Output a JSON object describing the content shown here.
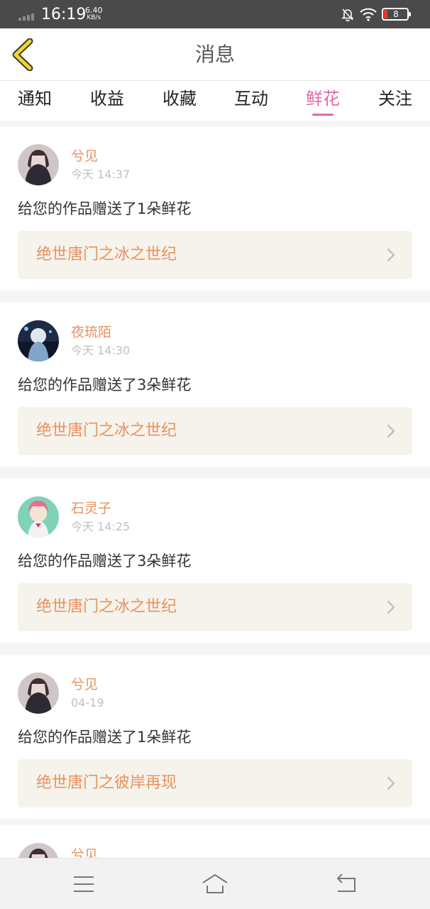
{
  "status_bar": {
    "time": "16:19",
    "net_speed_value": "6.40",
    "net_speed_unit": "KB/s",
    "battery_level": "8",
    "icons": [
      "signal-icon",
      "bell-off-icon",
      "wifi-icon",
      "battery-icon"
    ]
  },
  "header": {
    "title": "消息",
    "back_icon": "back-chevron-icon"
  },
  "tabs": [
    {
      "label": "通知",
      "active": false
    },
    {
      "label": "收益",
      "active": false
    },
    {
      "label": "收藏",
      "active": false
    },
    {
      "label": "互动",
      "active": false
    },
    {
      "label": "鲜花",
      "active": true
    },
    {
      "label": "关注",
      "active": false
    }
  ],
  "messages": [
    {
      "name": "兮见",
      "time": "今天 14:37",
      "text": "给您的作品赠送了1朵鲜花",
      "work": "绝世唐门之冰之世纪"
    },
    {
      "name": "夜琉陌",
      "time": "今天 14:30",
      "text": "给您的作品赠送了3朵鲜花",
      "work": "绝世唐门之冰之世纪"
    },
    {
      "name": "石灵子",
      "time": "今天 14:25",
      "text": "给您的作品赠送了3朵鲜花",
      "work": "绝世唐门之冰之世纪"
    },
    {
      "name": "兮见",
      "time": "04-19",
      "text": "给您的作品赠送了1朵鲜花",
      "work": "绝世唐门之彼岸再现"
    },
    {
      "name": "兮见"
    }
  ],
  "bottom_nav": {
    "icons": [
      "menu-icon",
      "home-icon",
      "back-icon"
    ]
  },
  "colors": {
    "accent": "#e06aa6",
    "name_orange": "#e8925f",
    "work_bg": "#f5f3ec"
  }
}
